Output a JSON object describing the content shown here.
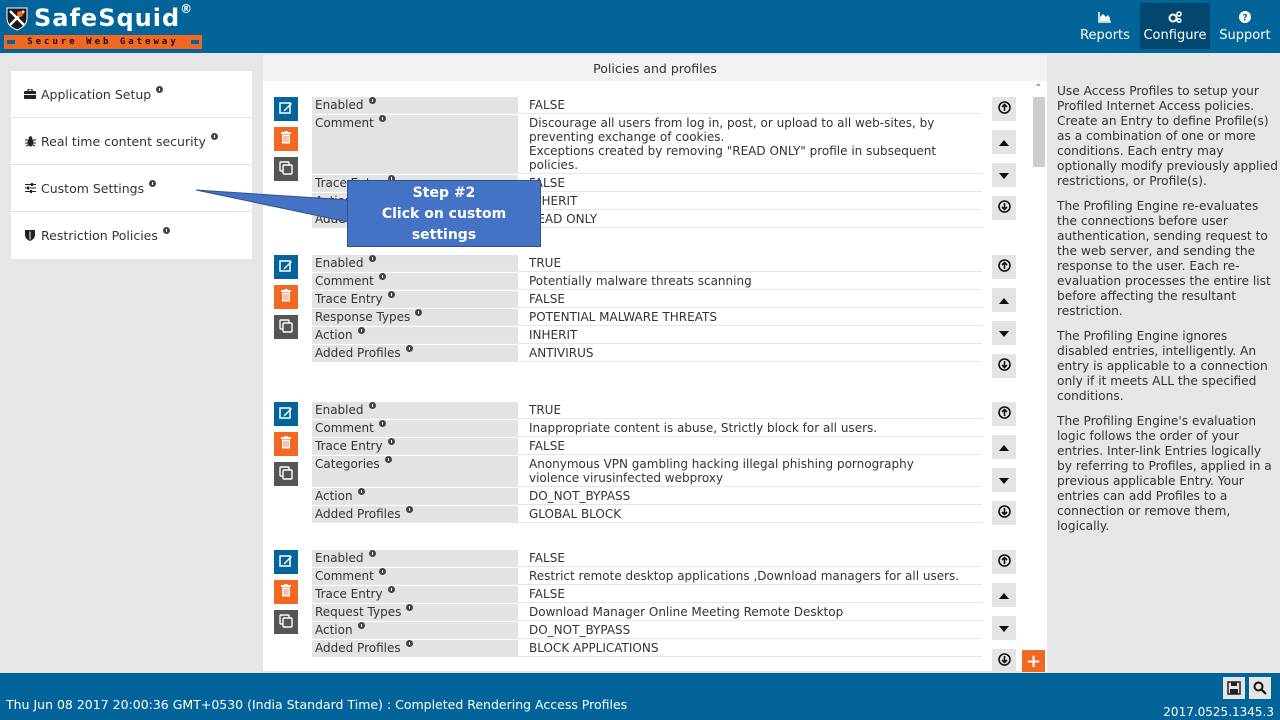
{
  "brand": {
    "name": "SafeSquid",
    "registered": "®",
    "tagline": "Secure Web Gateway",
    "colors": {
      "primary": "#03649a",
      "accent": "#f26722",
      "callout": "#4472c4"
    }
  },
  "nav": {
    "items": [
      {
        "label": "Reports",
        "icon": "area-chart-icon",
        "active": false
      },
      {
        "label": "Configure",
        "icon": "cogs-icon",
        "active": true
      },
      {
        "label": "Support",
        "icon": "question-circle-icon",
        "active": false
      }
    ]
  },
  "sidebar": {
    "items": [
      {
        "label": "Application Setup",
        "icon": "briefcase-icon"
      },
      {
        "label": "Real time content security",
        "icon": "bug-icon"
      },
      {
        "label": "Custom Settings",
        "icon": "sliders-icon"
      },
      {
        "label": "Restriction Policies",
        "icon": "shield-icon"
      }
    ]
  },
  "main": {
    "title": "Policies and profiles",
    "entries": [
      {
        "rows": [
          {
            "key": "Enabled",
            "value": "FALSE"
          },
          {
            "key": "Comment",
            "value": "Discourage all users from log in, post, or upload to all web-sites, by preventing exchange of cookies.\nExceptions created by removing \"READ ONLY\" profile in subsequent policies."
          },
          {
            "key": "Trace Entry",
            "value": "FALSE"
          },
          {
            "key": "Action",
            "value": "INHERIT"
          },
          {
            "key": "Added Profiles",
            "value": "READ ONLY"
          }
        ]
      },
      {
        "rows": [
          {
            "key": "Enabled",
            "value": "TRUE"
          },
          {
            "key": "Comment",
            "value": "Potentially malware threats scanning"
          },
          {
            "key": "Trace Entry",
            "value": "FALSE"
          },
          {
            "key": "Response Types",
            "value": "POTENTIAL MALWARE THREATS"
          },
          {
            "key": "Action",
            "value": "INHERIT"
          },
          {
            "key": "Added Profiles",
            "value": "ANTIVIRUS"
          }
        ]
      },
      {
        "rows": [
          {
            "key": "Enabled",
            "value": "TRUE"
          },
          {
            "key": "Comment",
            "value": "Inappropriate content is abuse, Strictly block for all users."
          },
          {
            "key": "Trace Entry",
            "value": "FALSE"
          },
          {
            "key": "Categories",
            "value": "Anonymous VPN  gambling  hacking  illegal  phishing  pornography\nviolence  virusinfected  webproxy"
          },
          {
            "key": "Action",
            "value": "DO_NOT_BYPASS"
          },
          {
            "key": "Added Profiles",
            "value": "GLOBAL BLOCK"
          }
        ]
      },
      {
        "rows": [
          {
            "key": "Enabled",
            "value": "FALSE"
          },
          {
            "key": "Comment",
            "value": "Restrict remote desktop applications ,Download managers for all users."
          },
          {
            "key": "Trace Entry",
            "value": "FALSE"
          },
          {
            "key": "Request Types",
            "value": "Download Manager  Online Meeting  Remote Desktop"
          },
          {
            "key": "Action",
            "value": "DO_NOT_BYPASS"
          },
          {
            "key": "Added Profiles",
            "value": "BLOCK APPLICATIONS"
          }
        ]
      }
    ]
  },
  "help": {
    "paragraphs": [
      "Use Access Profiles to setup your Profiled Internet Access policies. Create an Entry to define Profile(s) as a combination of one or more conditions. Each entry may optionally modify previously applied restrictions, or Profile(s).",
      "The Profiling Engine re-evaluates the connections before user authentication, sending request to the web server, and sending the response to the user. Each re-evaluation processes the entire list before affecting the resultant restriction.",
      "The Profiling Engine ignores disabled entries, intelligently. An entry is applicable to a connection only if it meets ALL the specified conditions.",
      "The Profiling Engine's evaluation logic follows the order of your entries. Inter-link Entries logically by referring to Profiles, applied in a previous applicable Entry. Your entries can add Profiles to a connection or remove them, logically."
    ]
  },
  "callout": {
    "line1": "Step #2",
    "line2": "Click on custom",
    "line3": "settings"
  },
  "footer": {
    "status": "Thu Jun 08 2017 20:00:36 GMT+0530 (India Standard Time) : Completed Rendering Access Profiles",
    "version": "2017.0525.1345.3"
  }
}
